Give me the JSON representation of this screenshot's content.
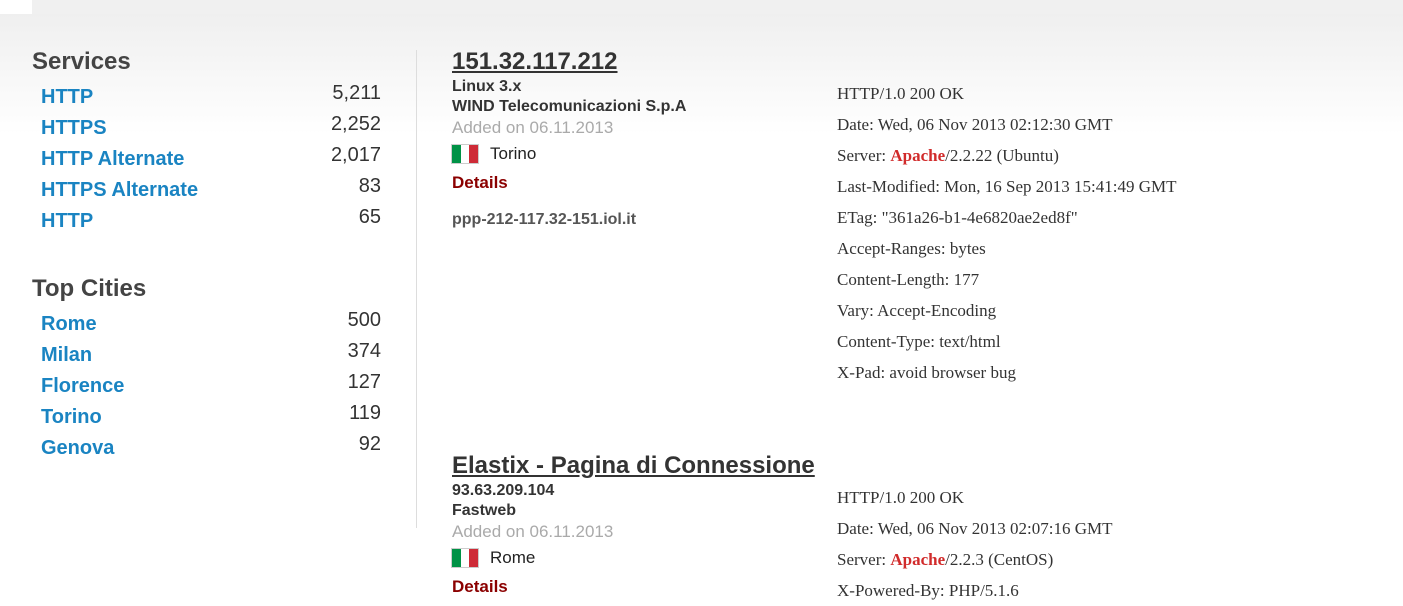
{
  "sidebar": {
    "services_heading": "Services",
    "services": [
      {
        "label": "HTTP",
        "count": "5,211"
      },
      {
        "label": "HTTPS",
        "count": "2,252"
      },
      {
        "label": "HTTP Alternate",
        "count": "2,017"
      },
      {
        "label": "HTTPS Alternate",
        "count": "83"
      },
      {
        "label": "HTTP",
        "count": "65"
      }
    ],
    "cities_heading": "Top Cities",
    "cities": [
      {
        "label": "Rome",
        "count": "500"
      },
      {
        "label": "Milan",
        "count": "374"
      },
      {
        "label": "Florence",
        "count": "127"
      },
      {
        "label": "Torino",
        "count": "119"
      },
      {
        "label": "Genova",
        "count": "92"
      }
    ]
  },
  "results": [
    {
      "title": "151.32.117.212",
      "line1": "Linux 3.x",
      "line2": "WIND Telecomunicazioni S.p.A",
      "added": "Added on 06.11.2013",
      "city": "Torino",
      "flag_icon": "italy-flag-icon",
      "details": "Details",
      "hostname": "ppp-212-117.32-151.iol.it",
      "banner": {
        "status": "HTTP/1.0 200 OK",
        "date": "Date: Wed, 06 Nov 2013 02:12:30 GMT",
        "server_prefix": "Server: ",
        "server_name": "Apache",
        "server_suffix": "/2.2.22 (Ubuntu)",
        "last_modified": "Last-Modified: Mon, 16 Sep 2013 15:41:49 GMT",
        "etag": "ETag: \"361a26-b1-4e6820ae2ed8f\"",
        "accept_ranges": "Accept-Ranges: bytes",
        "content_length": "Content-Length: 177",
        "vary": "Vary: Accept-Encoding",
        "content_type": "Content-Type: text/html",
        "x_pad": "X-Pad: avoid browser bug"
      }
    },
    {
      "title": "Elastix - Pagina di Connessione",
      "line1": "93.63.209.104",
      "line2": "Fastweb",
      "added": "Added on 06.11.2013",
      "city": "Rome",
      "flag_icon": "italy-flag-icon",
      "details": "Details",
      "banner": {
        "status": "HTTP/1.0 200 OK",
        "date": "Date: Wed, 06 Nov 2013 02:07:16 GMT",
        "server_prefix": "Server: ",
        "server_name": "Apache",
        "server_suffix": "/2.2.3 (CentOS)",
        "x_powered_by": "X-Powered-By: PHP/5.1.6"
      }
    }
  ],
  "colors": {
    "link_blue": "#1a84c2",
    "details_red": "#8b0000",
    "server_red": "#d12b2b",
    "flag_green": "#009246",
    "flag_white": "#ffffff",
    "flag_red": "#ce2b37"
  }
}
